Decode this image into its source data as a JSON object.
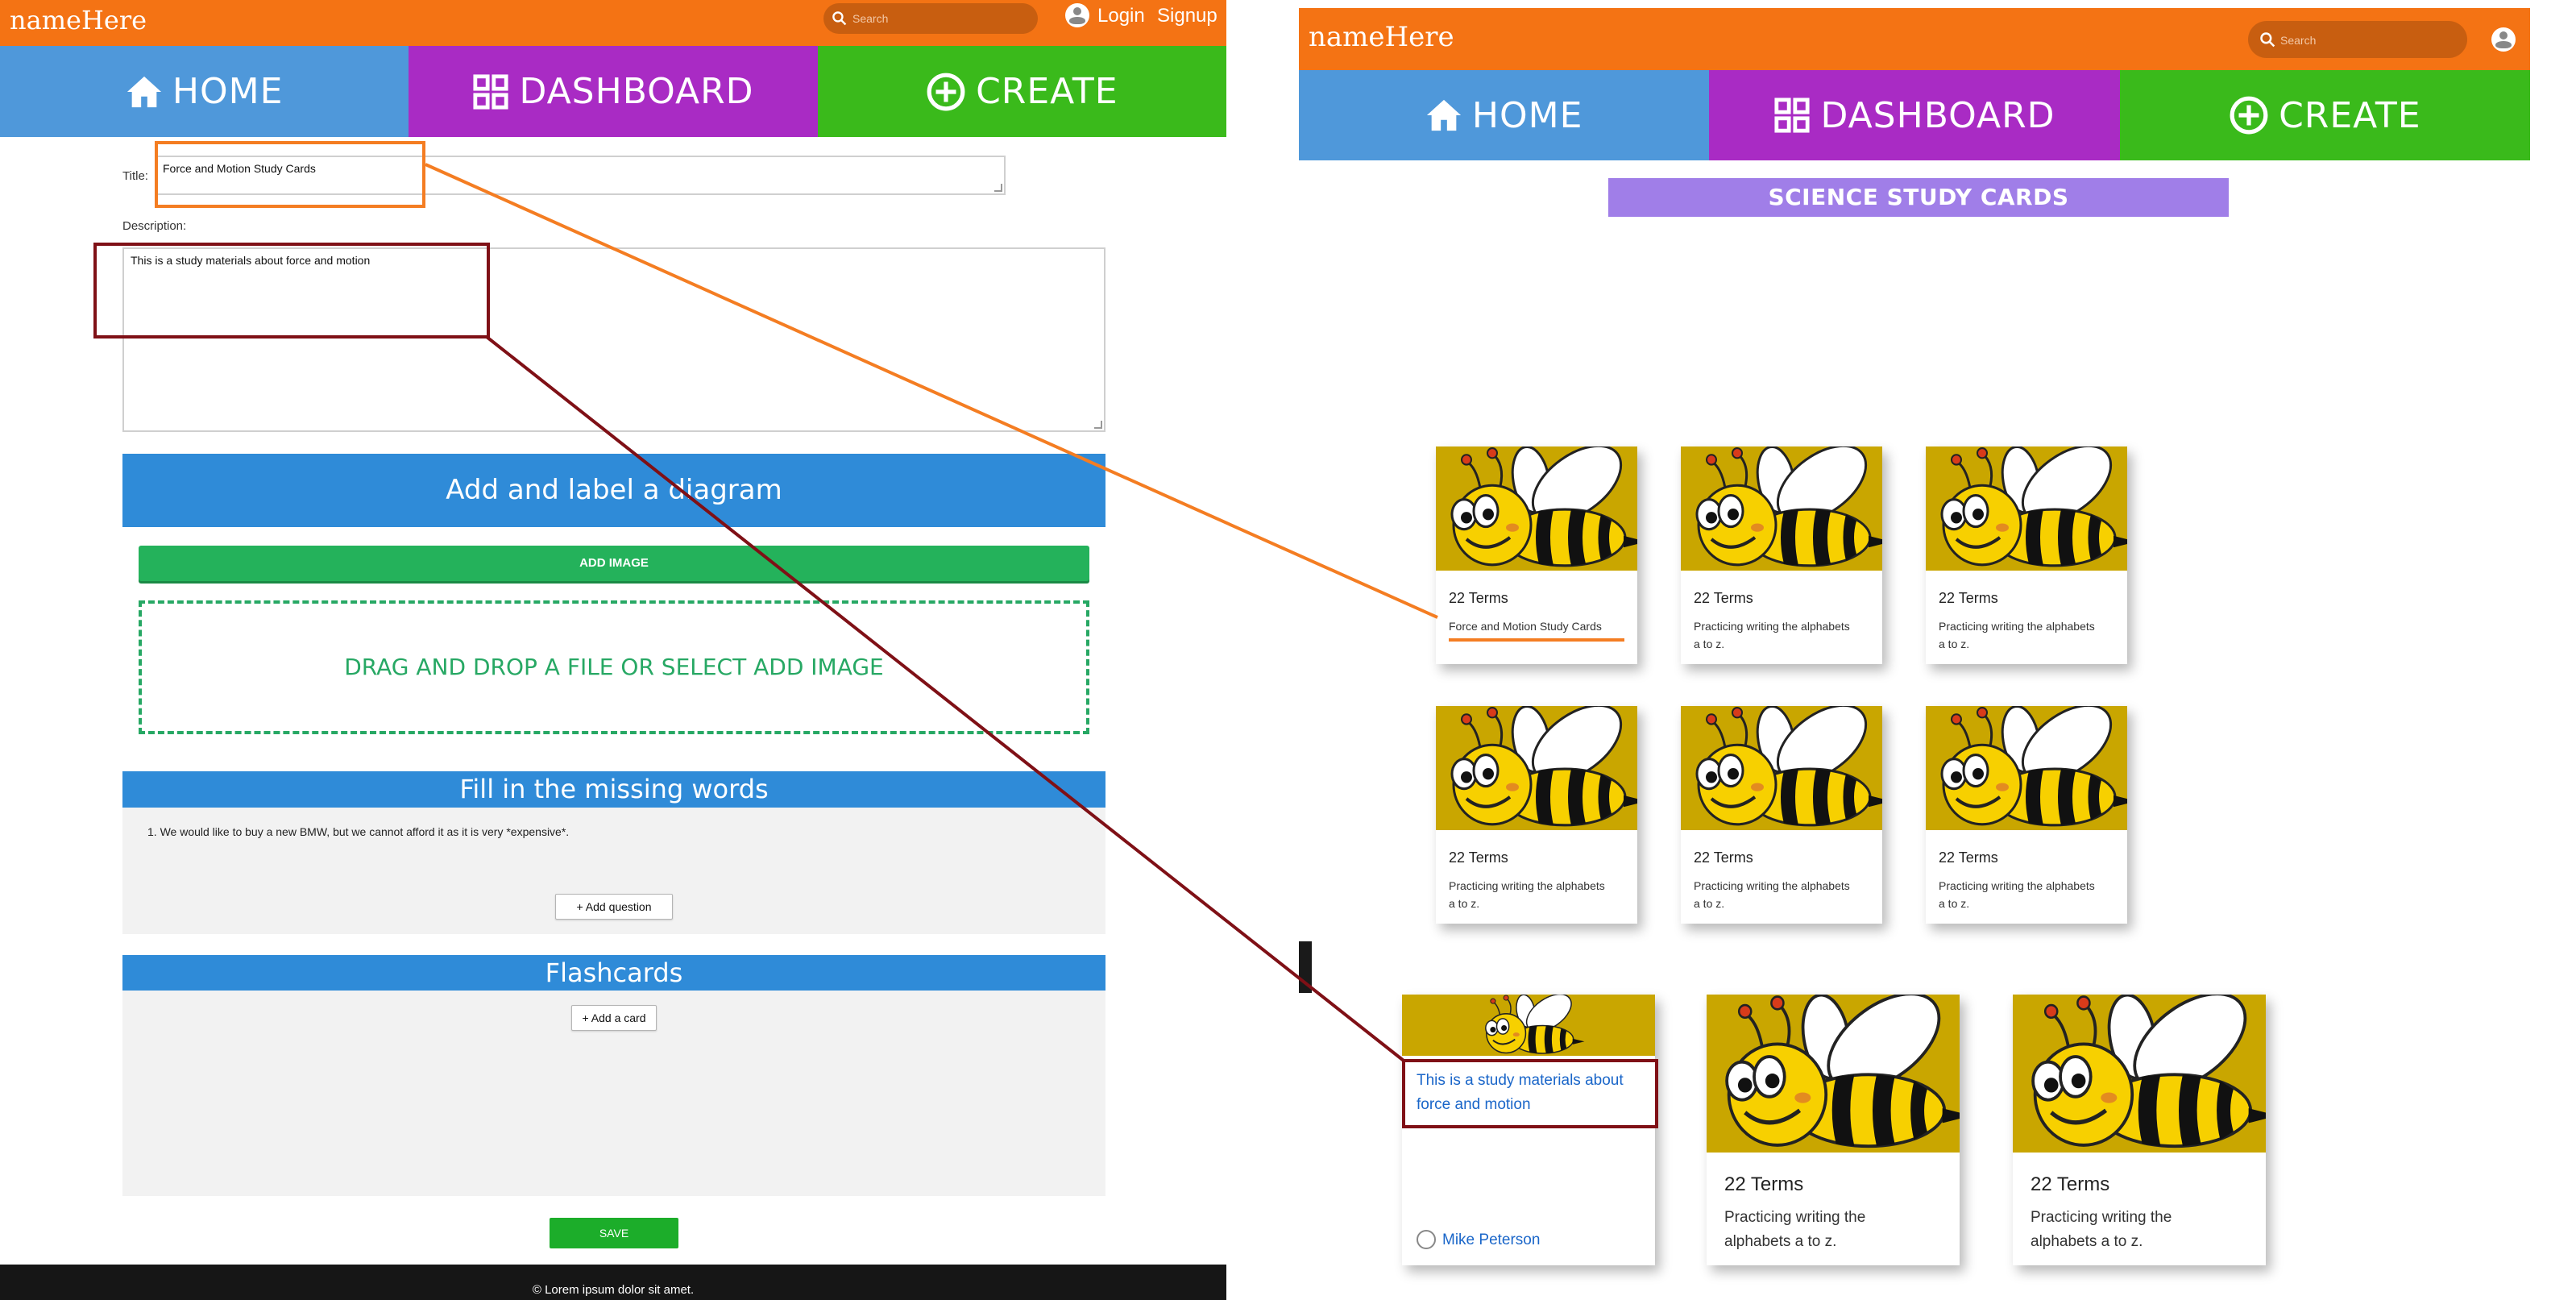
{
  "colors": {
    "topbar": "#f47314",
    "nav_home": "#4f98da",
    "nav_dashboard": "#a92bc4",
    "nav_create": "#3aba1b",
    "band_blue": "#2f8bd8",
    "add_image_green": "#24b25b",
    "section_pill": "#a07ee8",
    "highlight_orange": "#f47d22",
    "highlight_maroon": "#7f1016"
  },
  "editor": {
    "brand": "nameHere",
    "search_placeholder": "Search",
    "login": "Login",
    "signup": "Signup",
    "nav": {
      "home": "HOME",
      "dashboard": "DASHBOARD",
      "create": "CREATE"
    },
    "title_label": "Title:",
    "title_value": "Force and Motion Study Cards",
    "description_label": "Description:",
    "description_value": "This is a study materials about force and motion",
    "diagram_header": "Add and label a diagram",
    "add_image": "ADD IMAGE",
    "dropzone_text": "DRAG AND DROP A FILE OR SELECT ADD IMAGE",
    "missing_words_header": "Fill in the missing words",
    "question_1": "1. We would like to buy a new BMW, but we cannot afford it as it is very *expensive*.",
    "add_question": "+ Add question",
    "flashcards_header": "Flashcards",
    "add_card": "+ Add a card",
    "save": "SAVE",
    "footer": "© Lorem ipsum dolor sit amet."
  },
  "dashboard": {
    "brand": "nameHere",
    "search_placeholder": "Search",
    "nav": {
      "home": "HOME",
      "dashboard": "DASHBOARD",
      "create": "CREATE"
    },
    "section_title": "SCIENCE STUDY CARDS",
    "cards": [
      {
        "terms": "22 Terms",
        "desc": "Force and Motion Study Cards"
      },
      {
        "terms": "22 Terms",
        "desc": "Practicing writing the alphabets a to z."
      },
      {
        "terms": "22 Terms",
        "desc": "Practicing writing the alphabets a to z."
      },
      {
        "terms": "22 Terms",
        "desc": "Practicing writing the alphabets a to z."
      },
      {
        "terms": "22 Terms",
        "desc": "Practicing writing the alphabets a to z."
      },
      {
        "terms": "22 Terms",
        "desc": "Practicing writing the alphabets a to z."
      }
    ],
    "hover_card": {
      "desc": "This is a study materials about force and motion",
      "author": "Mike Peterson"
    },
    "big_cards": [
      {
        "terms": "22 Terms",
        "desc": "Practicing writing the alphabets a to z."
      },
      {
        "terms": "22 Terms",
        "desc": "Practicing writing the alphabets a to z."
      }
    ]
  }
}
